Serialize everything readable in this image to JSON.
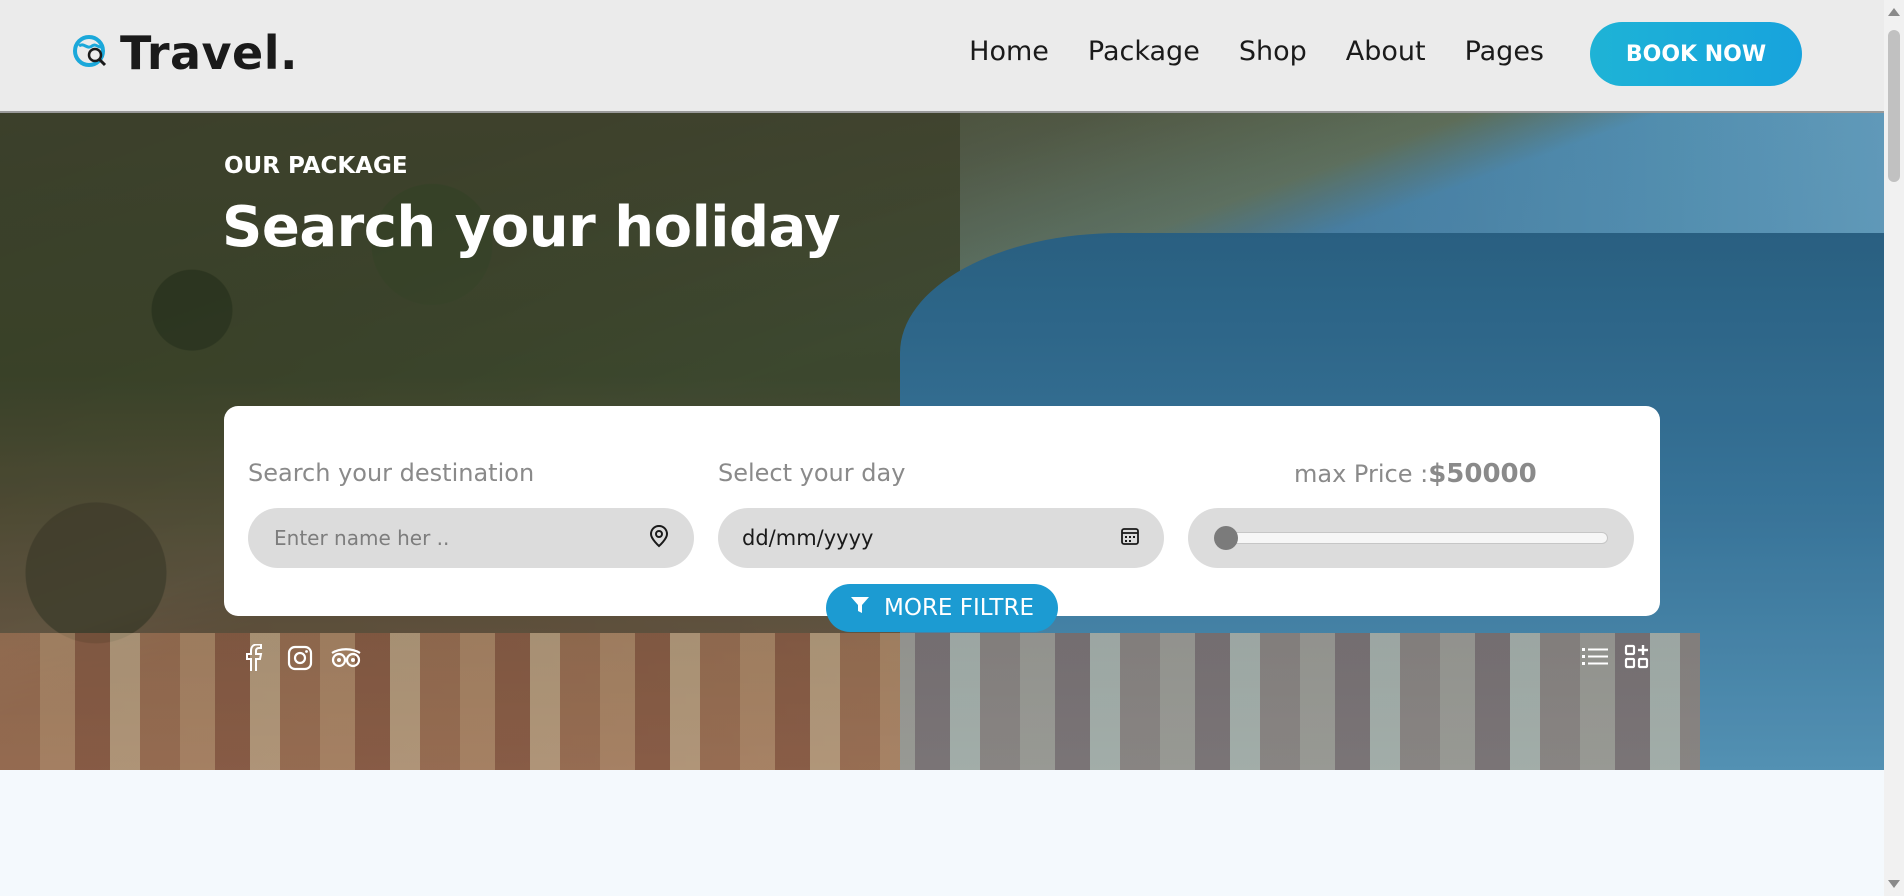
{
  "header": {
    "logo_text": "Travel.",
    "logo_icon": "globe-search-icon",
    "nav": [
      "Home",
      "Package",
      "Shop",
      "About",
      "Pages"
    ],
    "book_label": "BOOK NOW",
    "accent": "#1ba8da"
  },
  "hero": {
    "subtitle": "OUR PACKAGE",
    "title": "Search your holiday"
  },
  "search": {
    "destination_label": "Search your destination",
    "destination_placeholder": "Enter name her ..",
    "day_label": "Select your day",
    "day_value": "dd/mm/yyyy",
    "price_label": "max Price :",
    "price_value": "$50000",
    "slider_level": 0
  },
  "filter": {
    "label": "MORE FILTRE",
    "icon": "filter-icon",
    "color": "#1c9bd2"
  },
  "socials": [
    "facebook-icon",
    "instagram-icon",
    "tripadvisor-icon"
  ],
  "view_toggles": [
    "list-view-icon",
    "grid-view-icon"
  ]
}
